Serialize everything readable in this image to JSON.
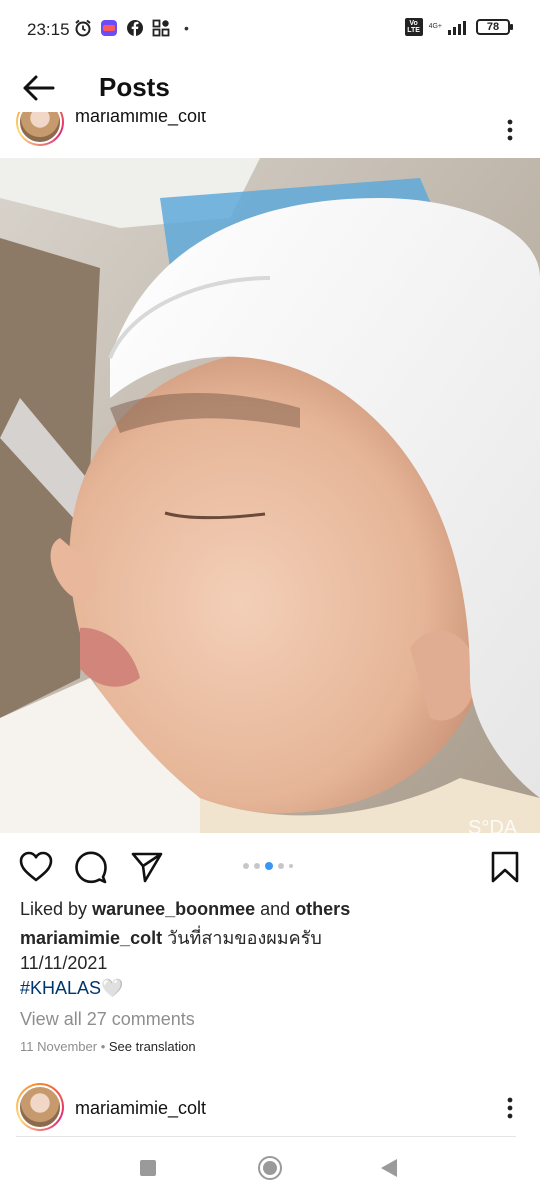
{
  "status_bar": {
    "time": "23:15",
    "volte": "Vo LTE",
    "network": "4G+",
    "battery": "78"
  },
  "header": {
    "title": "Posts",
    "back_icon": "arrow-left-icon"
  },
  "post": {
    "username": "mariamimie_colt",
    "photo_watermark": "S°DA",
    "carousel": {
      "total": 5,
      "active_index": 2
    },
    "likes": {
      "prefix": "Liked by",
      "user": "warunee_boonmee",
      "connector": "and",
      "others": "others"
    },
    "caption": {
      "user": "mariamimie_colt",
      "text": "วันที่สามของผมครับ",
      "date_line": "11/11/2021",
      "hashtag": "#KHALAS",
      "emoji": "🤍"
    },
    "view_comments": "View all 27 comments",
    "timestamp": "11 November",
    "separator": "•",
    "see_translation": "See translation"
  },
  "next_post": {
    "username": "mariamimie_colt"
  },
  "colors": {
    "hashtag": "#00376b",
    "carousel_active": "#3897f0",
    "muted_text": "#8e8e8e"
  }
}
